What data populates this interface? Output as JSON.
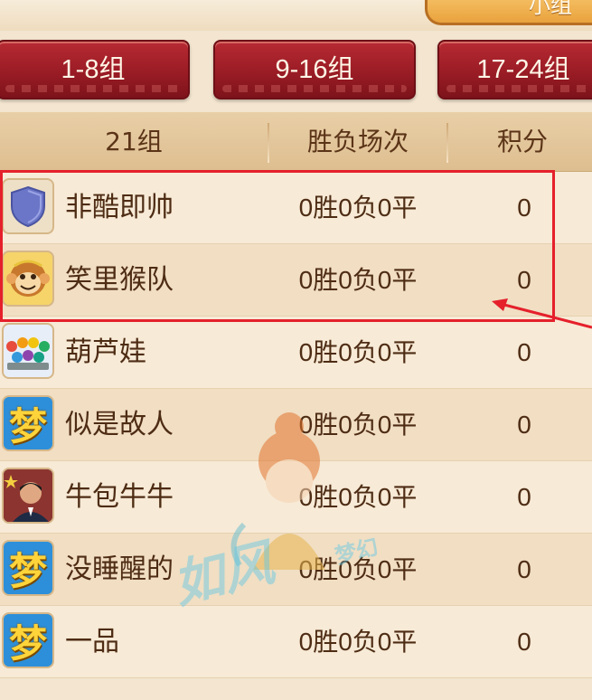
{
  "top_tab": {
    "label": "小组"
  },
  "group_buttons": [
    {
      "label": "1-8组"
    },
    {
      "label": "9-16组"
    },
    {
      "label": "17-24组"
    }
  ],
  "table": {
    "headers": {
      "group": "21组",
      "record": "胜负场次",
      "score": "积分"
    },
    "rows": [
      {
        "avatar_icon": "shield-icon",
        "name": "非酷即帅",
        "record": "0胜0负0平",
        "score": "0"
      },
      {
        "avatar_icon": "monkey-icon",
        "name": "笑里猴队",
        "record": "0胜0负0平",
        "score": "0"
      },
      {
        "avatar_icon": "calabash-brothers-icon",
        "name": "葫芦娃",
        "record": "0胜0负0平",
        "score": "0"
      },
      {
        "avatar_icon": "dream-logo-icon",
        "name": "似是故人",
        "record": "0胜0负0平",
        "score": "0"
      },
      {
        "avatar_icon": "portrait-photo-icon",
        "name": "牛包牛牛",
        "record": "0胜0负0平",
        "score": "0"
      },
      {
        "avatar_icon": "dream-logo-icon",
        "name": "没睡醒的",
        "record": "0胜0负0平",
        "score": "0"
      },
      {
        "avatar_icon": "dream-logo-icon",
        "name": "一品",
        "record": "0胜0负0平",
        "score": "0"
      }
    ]
  },
  "dream_glyph": "梦",
  "watermark": {
    "main": "如风",
    "sub": "梦幻"
  },
  "colors": {
    "button_red": "#9a1c25",
    "header_tan": "#e9cfa7",
    "highlight_red": "#e5202b",
    "text_brown": "#4e2c14"
  }
}
